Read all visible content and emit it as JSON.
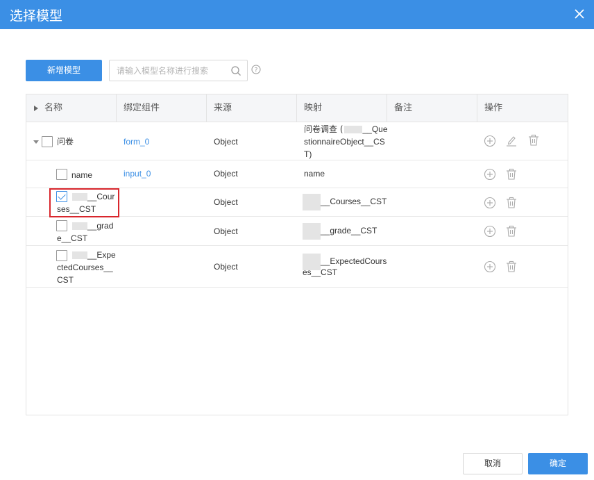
{
  "dialog": {
    "title": "选择模型",
    "close_icon": "close-icon"
  },
  "toolbar": {
    "add_label": "新增模型",
    "search_placeholder": "请输入模型名称进行搜索",
    "search_icon": "search-icon",
    "help_icon": "help-circle-icon"
  },
  "table": {
    "headers": [
      "名称",
      "绑定组件",
      "来源",
      "映射",
      "备注",
      "操作"
    ],
    "rows": [
      {
        "name": "问卷",
        "component": "form_0",
        "source": "Object",
        "mapping_l1": "问卷调查 (",
        "mapping_l1b": "__Que",
        "mapping_l2": "stionnaireObject__CS",
        "mapping_l3": "T)",
        "checked": false
      },
      {
        "name": "name",
        "component": "input_0",
        "source": "Object",
        "mapping": "name",
        "checked": false
      },
      {
        "name_l1": "__Cour",
        "name_l2": "ses__CST",
        "component": "",
        "source": "Object",
        "mapping": "__Courses__CST",
        "checked": true
      },
      {
        "name_l1": "__grad",
        "name_l2": "e__CST",
        "component": "",
        "source": "Object",
        "mapping": "__grade__CST",
        "checked": false
      },
      {
        "name_l1": "__Expe",
        "name_l2": "ctedCourses__",
        "name_l3": "CST",
        "component": "",
        "source": "Object",
        "mapping_l1": "__ExpectedCours",
        "mapping_l2": "es__CST",
        "checked": false
      }
    ]
  },
  "footer": {
    "cancel_label": "取消",
    "confirm_label": "确定"
  },
  "colors": {
    "primary": "#3b8fe5",
    "highlight": "#d9262c"
  }
}
